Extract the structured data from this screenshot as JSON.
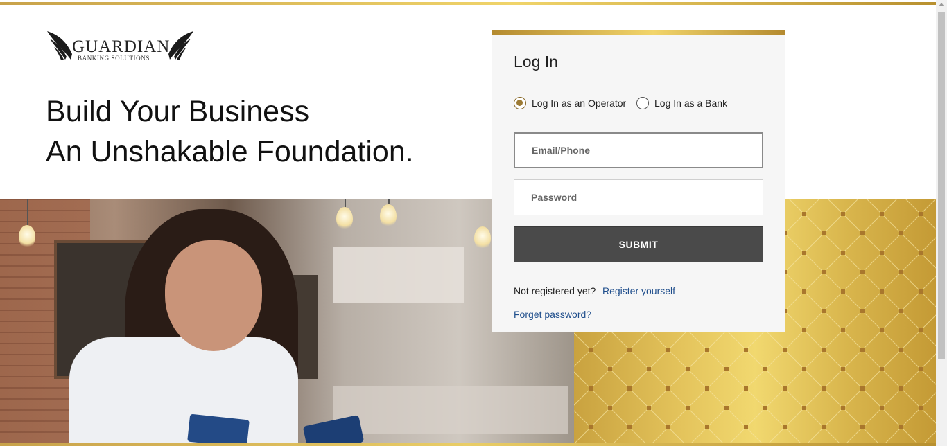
{
  "brand": {
    "name": "GUARDIAN",
    "subtitle": "BANKING SOLUTIONS"
  },
  "hero": {
    "line1": "Build Your Business",
    "line2": "An Unshakable Foundation."
  },
  "login": {
    "title": "Log In",
    "radio_operator": "Log In as an Operator",
    "radio_bank": "Log In as a Bank",
    "selected_role": "operator",
    "email_placeholder": "Email/Phone",
    "password_placeholder": "Password",
    "submit_label": "SUBMIT",
    "not_registered": "Not registered yet?",
    "register_link": "Register yourself",
    "forgot_link": "Forget password?"
  },
  "colors": {
    "gold": "#d9b64d",
    "submit_bg": "#4a4a4a",
    "link": "#1f4e8c"
  }
}
